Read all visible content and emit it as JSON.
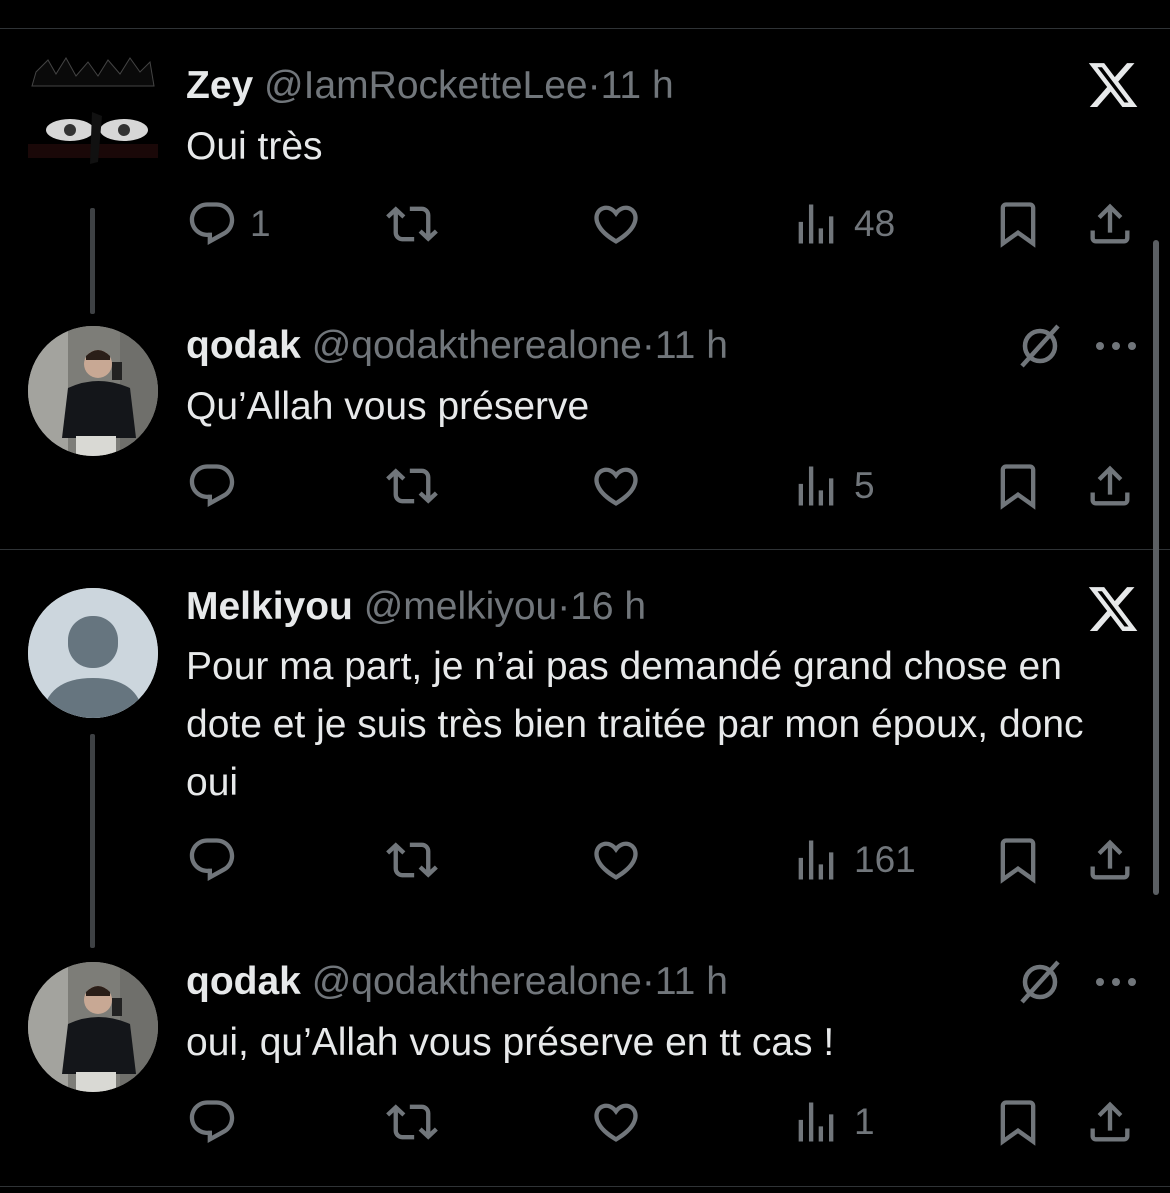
{
  "colors": {
    "background": "#000000",
    "text": "#e7e9ea",
    "muted": "#71767b",
    "divider": "#2f3336"
  },
  "tweets": [
    {
      "name": "Zey",
      "handle": "@IamRocketteLee",
      "separator": "·",
      "time": "11 h",
      "text": "Oui très",
      "badge_icon": "x-logo-icon",
      "avatar": "anime-eyes-avatar",
      "replies": "1",
      "views": "48"
    },
    {
      "name": "qodak",
      "handle": "@qodaktherealone",
      "separator": "·",
      "time": "11 h",
      "text": "Qu’Allah vous préserve",
      "badge_icon": "grok-icon",
      "avatar": "photo-avatar",
      "replies": "",
      "views": "5"
    },
    {
      "name": "Melkiyou",
      "handle": "@melkiyou",
      "separator": "·",
      "time": "16 h",
      "text": "Pour ma part, je n’ai pas demandé grand chose en dote et je suis très bien traitée par mon époux, donc oui",
      "badge_icon": "x-logo-icon",
      "avatar": "default-avatar",
      "replies": "",
      "views": "161"
    },
    {
      "name": "qodak",
      "handle": "@qodaktherealone",
      "separator": "·",
      "time": "11 h",
      "text": "oui, qu’Allah vous préserve en tt cas !",
      "badge_icon": "grok-icon",
      "avatar": "photo-avatar",
      "replies": "",
      "views": "1"
    }
  ]
}
